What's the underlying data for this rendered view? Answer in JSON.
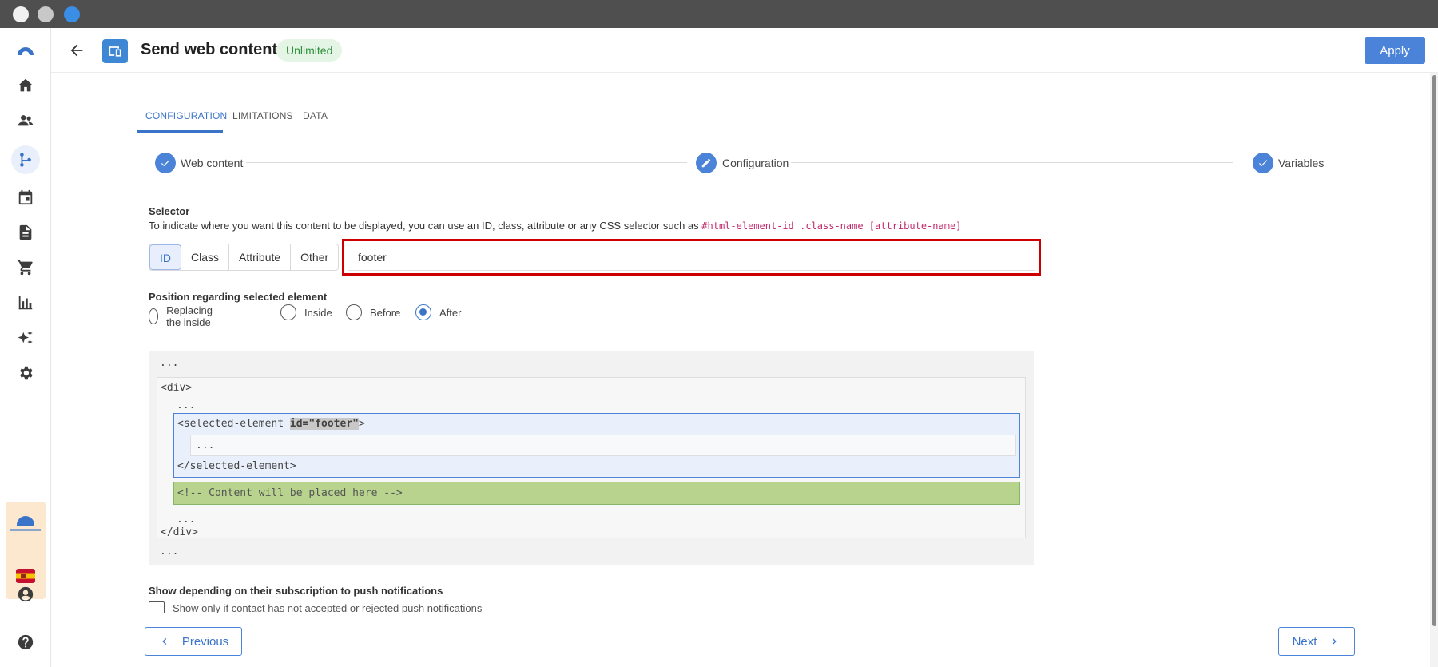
{
  "header": {
    "title": "Send web content",
    "badge": "Unlimited",
    "apply_label": "Apply"
  },
  "tabs": [
    {
      "label": "CONFIGURATION",
      "active": true
    },
    {
      "label": "LIMITATIONS",
      "active": false
    },
    {
      "label": "DATA",
      "active": false
    }
  ],
  "steps": [
    {
      "label": "Web content",
      "state": "done"
    },
    {
      "label": "Configuration",
      "state": "editing"
    },
    {
      "label": "Variables",
      "state": "done"
    }
  ],
  "selector": {
    "title": "Selector",
    "description": "To indicate where you want this content to be displayed, you can use an ID, class, attribute or any CSS selector such as",
    "examples": "#html-element-id .class-name [attribute-name]",
    "types": [
      "ID",
      "Class",
      "Attribute",
      "Other"
    ],
    "selected_type": "ID",
    "value": "footer"
  },
  "position": {
    "title": "Position regarding selected element",
    "options": [
      "Replacing the inside",
      "Inside",
      "Before",
      "After"
    ],
    "selected": "After"
  },
  "preview": {
    "ellipsis": "...",
    "div_open": "<div>",
    "div_close": "</div>",
    "selected_open": "<selected-element ",
    "selected_attr": "id=\"footer\"",
    "selected_open_end": ">",
    "selected_close": "</selected-element>",
    "content_comment": "<!-- Content will be placed here -->"
  },
  "push": {
    "title": "Show depending on their subscription to push notifications",
    "checkbox_label": "Show only if contact has not accepted or rejected push notifications",
    "checked": false
  },
  "footer": {
    "previous_label": "Previous",
    "next_label": "Next"
  },
  "colors": {
    "accent": "#4b83d8",
    "highlight_border": "#cc0000",
    "content_green": "#b7d38e",
    "badge_bg": "#e4f5e6"
  },
  "sidebar_icons": [
    "logo-icon",
    "home-icon",
    "contacts-icon",
    "workflow-icon",
    "calendar-icon",
    "document-icon",
    "cart-icon",
    "chart-icon",
    "sparkle-icon",
    "gear-icon",
    "account-icon",
    "help-icon"
  ]
}
